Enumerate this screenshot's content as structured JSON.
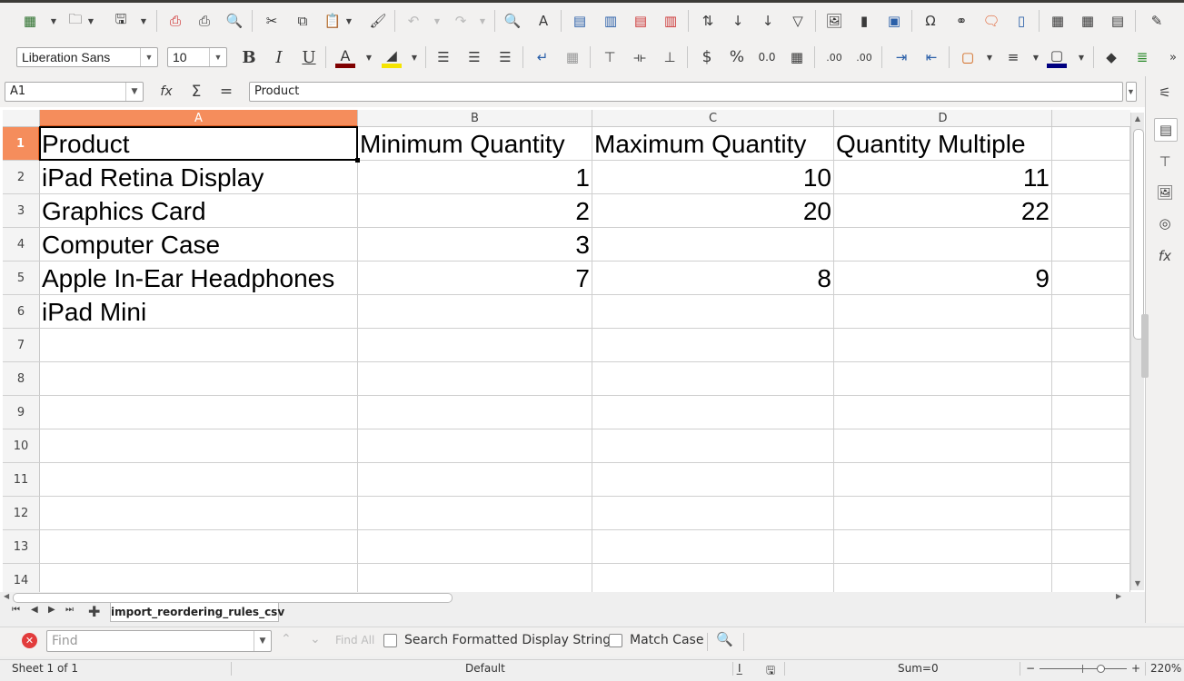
{
  "toolbar": {
    "font_name": "Liberation Sans",
    "font_size": "10",
    "bold": "B",
    "italic": "I",
    "underline": "U",
    "currency": "$",
    "percent": "%",
    "number_format": "0.0",
    "add_decimal": ".00",
    "del_decimal": ".00"
  },
  "formula_bar": {
    "name_box": "A1",
    "function_wizard": "fx",
    "sum": "Σ",
    "equals": "=",
    "content": "Product"
  },
  "columns": [
    "A",
    "B",
    "C",
    "D"
  ],
  "rows": [
    "1",
    "2",
    "3",
    "4",
    "5",
    "6",
    "7",
    "8",
    "9",
    "10",
    "11",
    "12",
    "13",
    "14"
  ],
  "cells": {
    "A1": "Product",
    "B1": "Minimum Quantity",
    "C1": "Maximum Quantity",
    "D1": "Quantity Multiple",
    "A2": "iPad Retina Display",
    "B2": "1",
    "C2": "10",
    "D2": "11",
    "A3": "Graphics Card",
    "B3": "2",
    "C3": "20",
    "D3": "22",
    "A4": "Computer Case",
    "B4": "3",
    "A5": "Apple In-Ear Headphones",
    "B5": "7",
    "C5": "8",
    "D5": "9",
    "A6": "iPad Mini"
  },
  "sheet_tab": "import_reordering_rules_csv",
  "find": {
    "placeholder": "Find",
    "find_all": "Find All",
    "search_formatted": "Search Formatted Display String",
    "match_case": "Match Case"
  },
  "status": {
    "sheet": "Sheet 1 of 1",
    "style": "Default",
    "sum": "Sum=0",
    "zoom": "220%"
  },
  "colors": {
    "selected_header": "#f58d5c",
    "accent": "#e05a1d"
  }
}
